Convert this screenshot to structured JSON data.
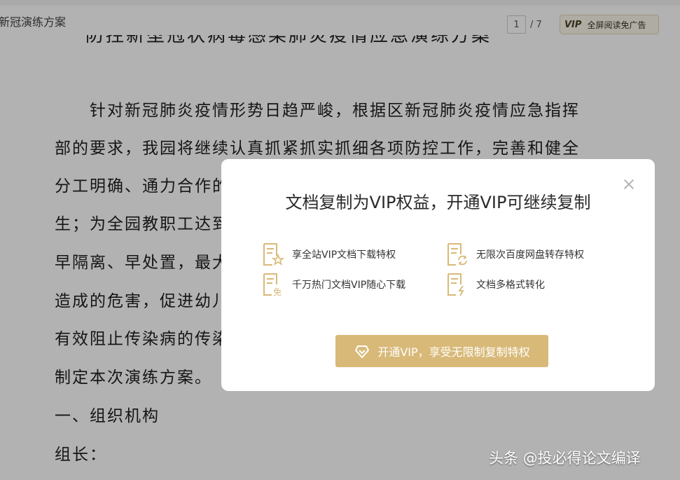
{
  "topbar": {
    "doc_title": "新冠演练方案",
    "page_current": "1",
    "page_total": "/ 7",
    "vip_badge": "VIP",
    "fullscreen_label": "全屏阅读免广告"
  },
  "document": {
    "heading": "防控新型冠状病毒感染肺炎疫情应急演练方案",
    "lines": [
      "　　针对新冠肺炎疫情形势日趋严峻，根据区新冠肺炎疫情应急指挥",
      "部的要求，我园将继续认真抓紧抓实抓细各项防控工作，完善和健全",
      "分工明确、通力合作的",
      "生；为全园教职工达到",
      "早隔离、早处置，最大",
      "造成的危害，促进幼儿",
      "有效阻止传染病的传染",
      "制定本次演练方案。",
      "一、组织机构",
      "组长："
    ]
  },
  "modal": {
    "title": "文档复制为VIP权益，开通VIP可继续复制",
    "benefits": [
      {
        "label": "享全站VIP文档下载特权",
        "icon": "doc-star-icon"
      },
      {
        "label": "无限次百度网盘转存特权",
        "icon": "doc-refresh-icon"
      },
      {
        "label": "千万热门文档VIP随心下载",
        "icon": "doc-free-icon"
      },
      {
        "label": "文档多格式转化",
        "icon": "doc-convert-icon"
      }
    ],
    "cta_label": "开通VIP，享受无限制复制特权",
    "accent_color": "#d8b978"
  },
  "watermark": "头条 @投必得论文编译"
}
